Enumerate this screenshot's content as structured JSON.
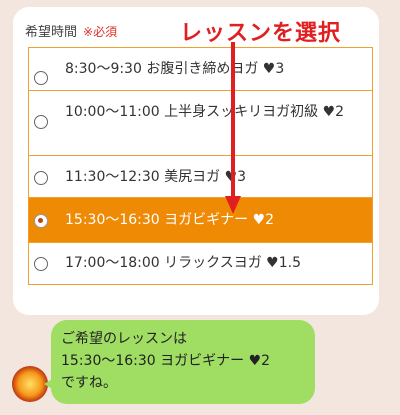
{
  "form": {
    "label": "希望時間",
    "required": "※必須",
    "options": [
      {
        "text": "8:30〜9:30 お腹引き締めヨガ ♥3",
        "selected": false
      },
      {
        "text": "10:00〜11:00 上半身スッキリヨガ初級 ♥2",
        "selected": false
      },
      {
        "text": "11:30〜12:30 美尻ヨガ ♥3",
        "selected": false
      },
      {
        "text": "15:30〜16:30 ヨガビギナー ♥2",
        "selected": true
      },
      {
        "text": "17:00〜18:00 リラックスヨガ ♥1.5",
        "selected": false
      }
    ]
  },
  "annotation": {
    "text": "レッスンを選択",
    "color": "#e02020"
  },
  "chat": {
    "lines": [
      "ご希望のレッスンは",
      "15:30〜16:30 ヨガビギナー ♥2",
      "ですね。"
    ],
    "bubble_color": "#9fdd63"
  },
  "colors": {
    "accent": "#ef8a05",
    "border": "#f0a030",
    "background": "#f2e6df"
  }
}
